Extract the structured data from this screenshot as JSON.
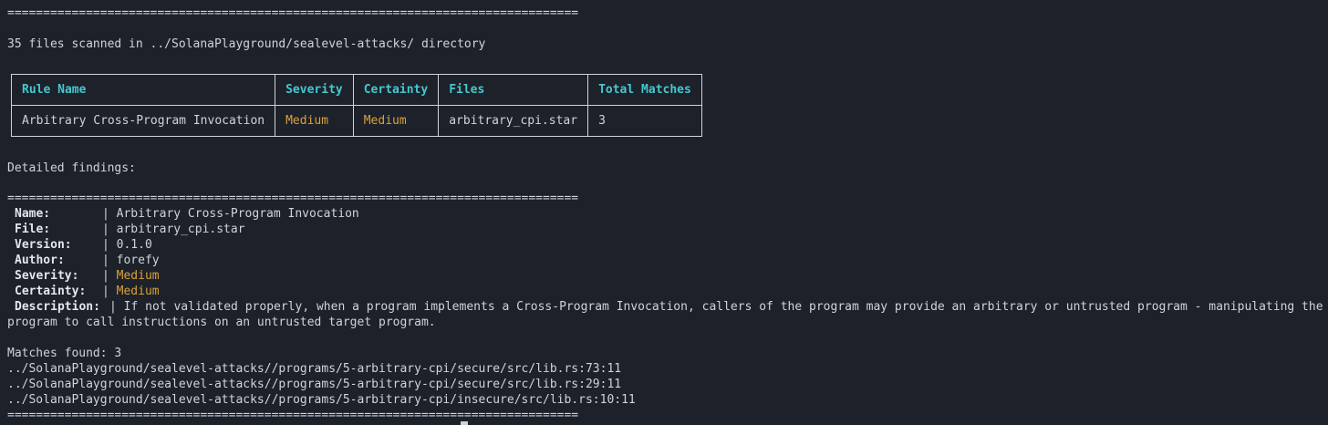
{
  "separator": "================================================================================",
  "scan_summary": "35 files scanned in ../SolanaPlayground/sealevel-attacks/ directory",
  "table": {
    "headers": [
      "Rule Name",
      "Severity",
      "Certainty",
      "Files",
      "Total Matches"
    ],
    "rows": [
      {
        "rule_name": "Arbitrary Cross-Program Invocation",
        "severity": "Medium",
        "certainty": "Medium",
        "files": "arbitrary_cpi.star",
        "total_matches": "3"
      }
    ]
  },
  "detailed_heading": "Detailed findings:",
  "details": {
    "name_key": "Name:",
    "name_val": "Arbitrary Cross-Program Invocation",
    "file_key": "File:",
    "file_val": "arbitrary_cpi.star",
    "version_key": "Version:",
    "version_val": "0.1.0",
    "author_key": "Author:",
    "author_val": "forefy",
    "severity_key": "Severity:",
    "severity_val": "Medium",
    "certainty_key": "Certainty:",
    "certainty_val": "Medium",
    "description_key": "Description:",
    "description_val": "If not validated properly, when a program implements a Cross-Program Invocation, callers of the program may provide an arbitrary or untrusted program - manipulating the program to call instructions on an untrusted target program.",
    "pipe": "| "
  },
  "matches_heading": "Matches found: 3",
  "matches": [
    "../SolanaPlayground/sealevel-attacks//programs/5-arbitrary-cpi/secure/src/lib.rs:73:11",
    "../SolanaPlayground/sealevel-attacks//programs/5-arbitrary-cpi/secure/src/lib.rs:29:11",
    "../SolanaPlayground/sealevel-attacks//programs/5-arbitrary-cpi/insecure/src/lib.rs:10:11"
  ],
  "colors": {
    "background": "#1d2129",
    "text": "#cfd4da",
    "header_cyan": "#45c7cf",
    "medium_orange": "#d9a23a"
  }
}
